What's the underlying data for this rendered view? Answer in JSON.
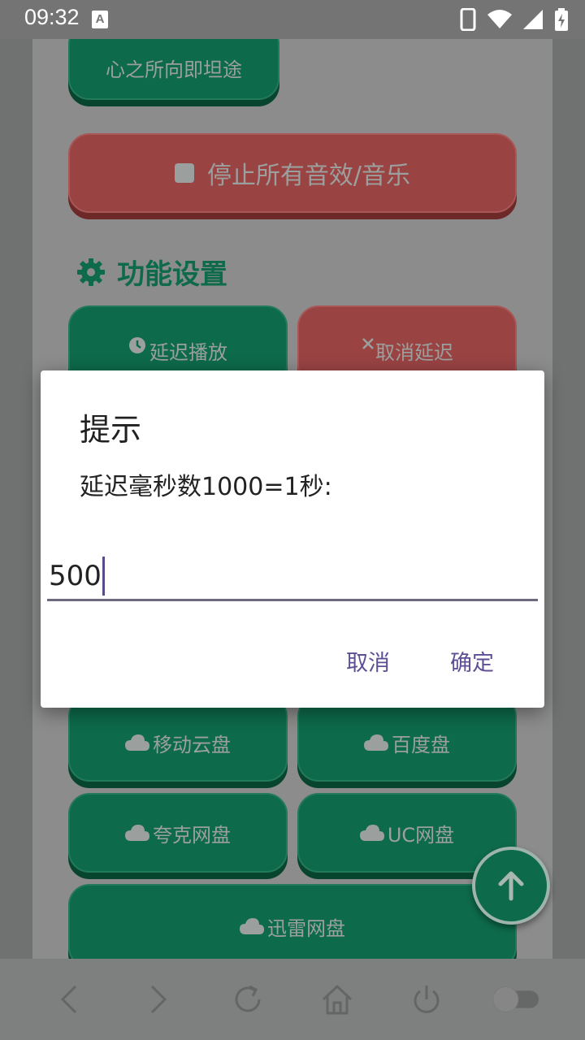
{
  "status_bar": {
    "time": "09:32",
    "notif_letter": "A"
  },
  "buttons": {
    "top_partial": "心之所向即坦途",
    "stop_all": "停止所有音效/音乐",
    "delay_play": "延迟播放",
    "cancel_delay": "取消延迟",
    "mobile_cloud": "移动云盘",
    "baidu": "百度盘",
    "quark": "夸克网盘",
    "uc": "UC网盘",
    "xunlei": "迅雷网盘"
  },
  "section": {
    "title": "功能设置"
  },
  "dialog": {
    "title": "提示",
    "message": "延迟毫秒数1000=1秒:",
    "input_value": "500",
    "cancel": "取消",
    "ok": "确定"
  },
  "colors": {
    "green": "#0d6a4a",
    "red": "#9a4343",
    "accent": "#5e4e94"
  }
}
